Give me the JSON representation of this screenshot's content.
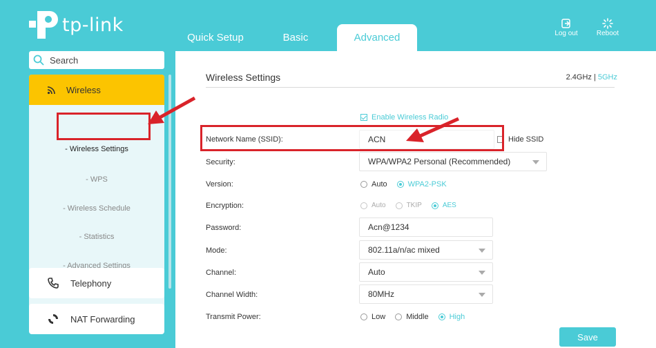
{
  "brand": {
    "name": "tp-link",
    "accent": "#4acbd6",
    "highlight": "#fcc400"
  },
  "header": {
    "tabs": [
      {
        "label": "Quick Setup",
        "active": false
      },
      {
        "label": "Basic",
        "active": false
      },
      {
        "label": "Advanced",
        "active": true
      }
    ],
    "logout_label": "Log out",
    "reboot_label": "Reboot"
  },
  "sidebar": {
    "search_label": "Search",
    "wireless": {
      "label": "Wireless",
      "icon": "wifi-icon",
      "items": [
        {
          "label": "- Wireless Settings",
          "current": true
        },
        {
          "label": "- WPS",
          "current": false
        },
        {
          "label": "- Wireless Schedule",
          "current": false
        },
        {
          "label": "- Statistics",
          "current": false
        },
        {
          "label": "- Advanced Settings",
          "current": false
        }
      ]
    },
    "items": [
      {
        "label": "Telephony",
        "icon": "phone-icon"
      },
      {
        "label": "NAT Forwarding",
        "icon": "nat-icon"
      }
    ]
  },
  "main": {
    "title": "Wireless Settings",
    "band_24": "2.4GHz",
    "band_sep": "|",
    "band_5": "5GHz",
    "enable_radio_label": "Enable Wireless Radio",
    "ssid": {
      "label": "Network Name (SSID):",
      "value": "ACN",
      "hide_label": "Hide SSID"
    },
    "security": {
      "label": "Security:",
      "value": "WPA/WPA2 Personal (Recommended)"
    },
    "version": {
      "label": "Version:",
      "options": [
        "Auto",
        "WPA2-PSK"
      ],
      "selected": "WPA2-PSK"
    },
    "encryption": {
      "label": "Encryption:",
      "options": [
        "Auto",
        "TKIP",
        "AES"
      ],
      "selected": "AES"
    },
    "password": {
      "label": "Password:",
      "value": "Acn@1234"
    },
    "mode": {
      "label": "Mode:",
      "value": "802.11a/n/ac mixed"
    },
    "channel": {
      "label": "Channel:",
      "value": "Auto"
    },
    "channel_width": {
      "label": "Channel Width:",
      "value": "80MHz"
    },
    "transmit_power": {
      "label": "Transmit Power:",
      "options": [
        "Low",
        "Middle",
        "High"
      ],
      "selected": "High"
    },
    "save_label": "Save"
  }
}
